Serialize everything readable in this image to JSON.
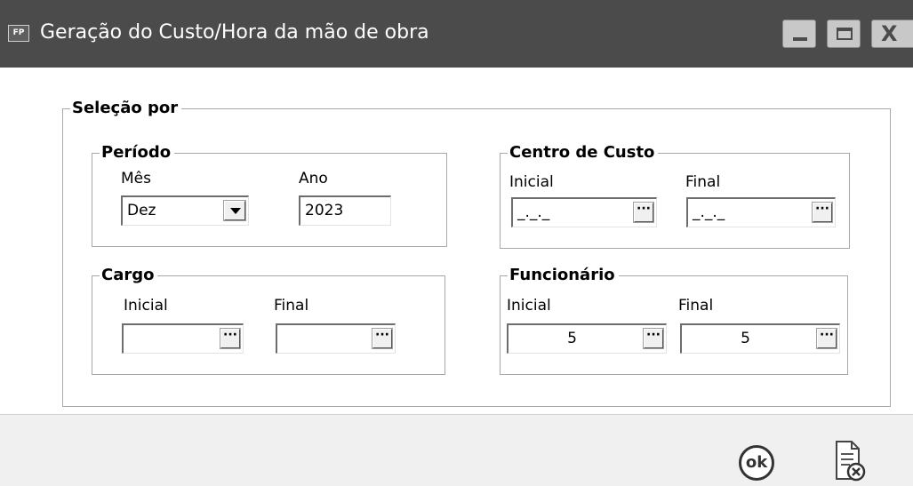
{
  "window": {
    "icon_text": "FP",
    "title": "Geração do Custo/Hora da mão de obra"
  },
  "selection": {
    "title": "Seleção por",
    "periodo": {
      "title": "Período",
      "mes_label": "Mês",
      "mes_value": "Dez",
      "ano_label": "Ano",
      "ano_value": "2023"
    },
    "centro_custo": {
      "title": "Centro de Custo",
      "inicial_label": "Inicial",
      "inicial_value": "_._._",
      "final_label": "Final",
      "final_value": "_._._"
    },
    "cargo": {
      "title": "Cargo",
      "inicial_label": "Inicial",
      "inicial_value": "",
      "final_label": "Final",
      "final_value": ""
    },
    "funcionario": {
      "title": "Funcionário",
      "inicial_label": "Inicial",
      "inicial_value": "5",
      "final_label": "Final",
      "final_value": "5"
    }
  },
  "footer": {
    "ok_label": "ok"
  },
  "lookup_button_glyph": "···"
}
